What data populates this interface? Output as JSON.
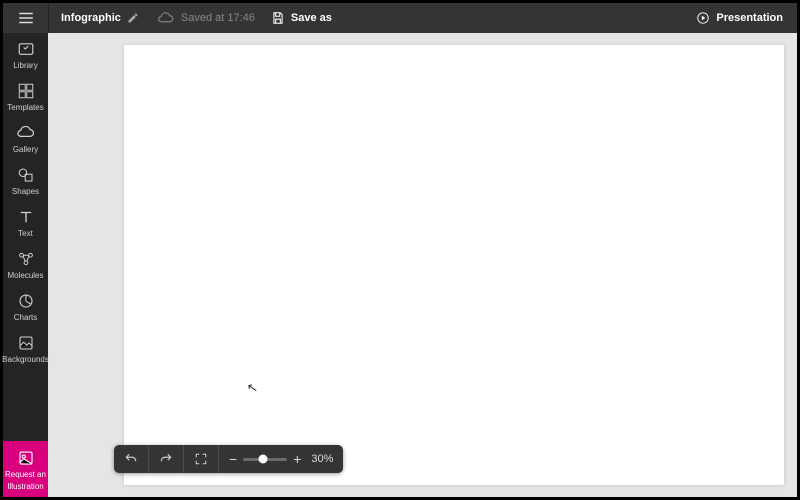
{
  "header": {
    "doc_type": "Infographic",
    "saved_status": "Saved at 17:46",
    "save_as_label": "Save as",
    "presentation_label": "Presentation"
  },
  "sidebar": {
    "items": [
      {
        "label": "Library"
      },
      {
        "label": "Templates"
      },
      {
        "label": "Gallery"
      },
      {
        "label": "Shapes"
      },
      {
        "label": "Text"
      },
      {
        "label": "Molecules"
      },
      {
        "label": "Charts"
      },
      {
        "label": "Backgrounds"
      }
    ],
    "request": {
      "line1": "Request an",
      "line2": "Illustration"
    }
  },
  "bottombar": {
    "zoom_minus": "−",
    "zoom_plus": "+",
    "zoom_percent": "30%"
  }
}
